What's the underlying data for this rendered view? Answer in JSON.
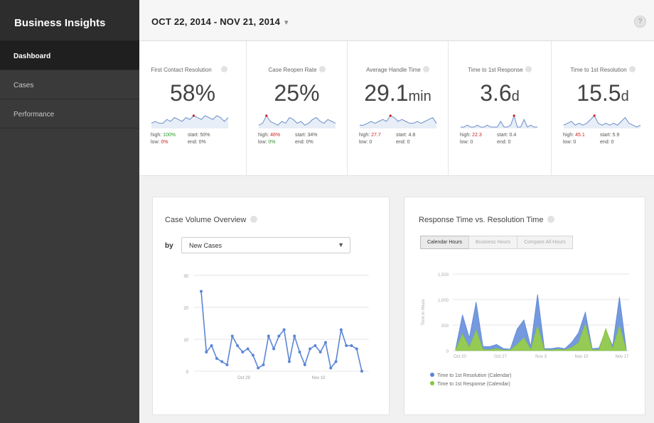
{
  "app": {
    "title": "Business Insights"
  },
  "nav": [
    {
      "label": "Dashboard"
    },
    {
      "label": "Cases"
    },
    {
      "label": "Performance"
    }
  ],
  "header": {
    "date_range": "OCT 22, 2014 - NOV 21, 2014",
    "help": "?"
  },
  "kpis": [
    {
      "label": "First Contact Resolution",
      "value": "58%",
      "unit": "",
      "high": "100%",
      "low": "0%",
      "start": "50%",
      "end": "0%",
      "spark": [
        2,
        3,
        2,
        2,
        4,
        3,
        5,
        4,
        3,
        5,
        4,
        6,
        5,
        4,
        6,
        5,
        4,
        6,
        5,
        3,
        5
      ]
    },
    {
      "label": "Case Reopen Rate",
      "value": "25%",
      "unit": "",
      "high": "46%",
      "low": "0%",
      "start": "34%",
      "end": "0%",
      "spark": [
        1,
        2,
        6,
        3,
        2,
        1,
        3,
        2,
        5,
        4,
        2,
        3,
        1,
        2,
        4,
        5,
        3,
        2,
        4,
        3,
        2
      ]
    },
    {
      "label": "Average Handle Time",
      "value": "29.1",
      "unit": "min",
      "high": "27.7",
      "low": "0",
      "start": "4.8",
      "end": "0",
      "spark": [
        1,
        1,
        2,
        3,
        2,
        3,
        4,
        3,
        6,
        5,
        3,
        4,
        3,
        2,
        2,
        3,
        2,
        3,
        4,
        5,
        2
      ]
    },
    {
      "label": "Time to 1st Response",
      "value": "3.6",
      "unit": "d",
      "high": "22.3",
      "low": "0",
      "start": "0.4",
      "end": "0",
      "spark": [
        0,
        0,
        1,
        0,
        0,
        1,
        0,
        0,
        1,
        0,
        0,
        0,
        3,
        0,
        0,
        1,
        6,
        0,
        0,
        4,
        0,
        1,
        0,
        0
      ]
    },
    {
      "label": "Time to 1st Resolution",
      "value": "15.5",
      "unit": "d",
      "high": "45.1",
      "low": "0",
      "start": "5.9",
      "end": "0",
      "spark": [
        1,
        2,
        3,
        1,
        2,
        1,
        2,
        4,
        6,
        2,
        1,
        2,
        1,
        2,
        1,
        3,
        5,
        2,
        1,
        0,
        1
      ]
    }
  ],
  "case_volume": {
    "title": "Case Volume Overview",
    "by_label": "by",
    "select_value": "New Cases",
    "y_ticks": [
      "0",
      "10",
      "20",
      "30"
    ],
    "x_ticks": [
      "Oct 29",
      "Nov 10"
    ]
  },
  "response_time": {
    "title": "Response Time vs. Resolution Time",
    "tabs": [
      "Calendar Hours",
      "Business Hours",
      "Compare All Hours"
    ],
    "y_axis_label": "Time in Hours",
    "y_ticks": [
      "0",
      "500",
      "1,000",
      "1,500"
    ],
    "x_ticks": [
      "Oct 20",
      "Oct 27",
      "Nov 3",
      "Nov 10",
      "Nov 17"
    ],
    "legend": [
      {
        "label": "Time to 1st Resolution (Calendar)",
        "color": "#5b86d6"
      },
      {
        "label": "Time to 1st Response (Calendar)",
        "color": "#88c43c"
      }
    ]
  },
  "chart_data": [
    {
      "type": "line",
      "title": "Case Volume Overview",
      "ylim": [
        0,
        30
      ],
      "x_ticks": [
        "Oct 29",
        "Nov 10"
      ],
      "series": [
        {
          "values": [
            25,
            6,
            8,
            4,
            3,
            2,
            11,
            8,
            6,
            7,
            5,
            1,
            2,
            11,
            7,
            11,
            13,
            3,
            11,
            6,
            2,
            7,
            8,
            6,
            9,
            1,
            3,
            13,
            8,
            8,
            7,
            0
          ]
        }
      ]
    },
    {
      "type": "area",
      "title": "Response Time vs. Resolution Time",
      "ylabel": "Time in Hours",
      "ylim": [
        0,
        1500
      ],
      "x_ticks": [
        "Oct 20",
        "Oct 27",
        "Nov 3",
        "Nov 10",
        "Nov 17"
      ],
      "series": [
        {
          "name": "Time to 1st Resolution (Calendar)",
          "values": [
            40,
            700,
            250,
            950,
            80,
            80,
            120,
            40,
            30,
            420,
            600,
            80,
            1100,
            40,
            40,
            60,
            40,
            160,
            350,
            750,
            40,
            50,
            400,
            90,
            1050,
            30
          ]
        },
        {
          "name": "Time to 1st Response (Calendar)",
          "values": [
            20,
            320,
            60,
            400,
            20,
            15,
            40,
            10,
            10,
            120,
            250,
            20,
            480,
            15,
            10,
            25,
            15,
            60,
            150,
            520,
            15,
            15,
            430,
            40,
            480,
            10
          ]
        }
      ]
    }
  ]
}
